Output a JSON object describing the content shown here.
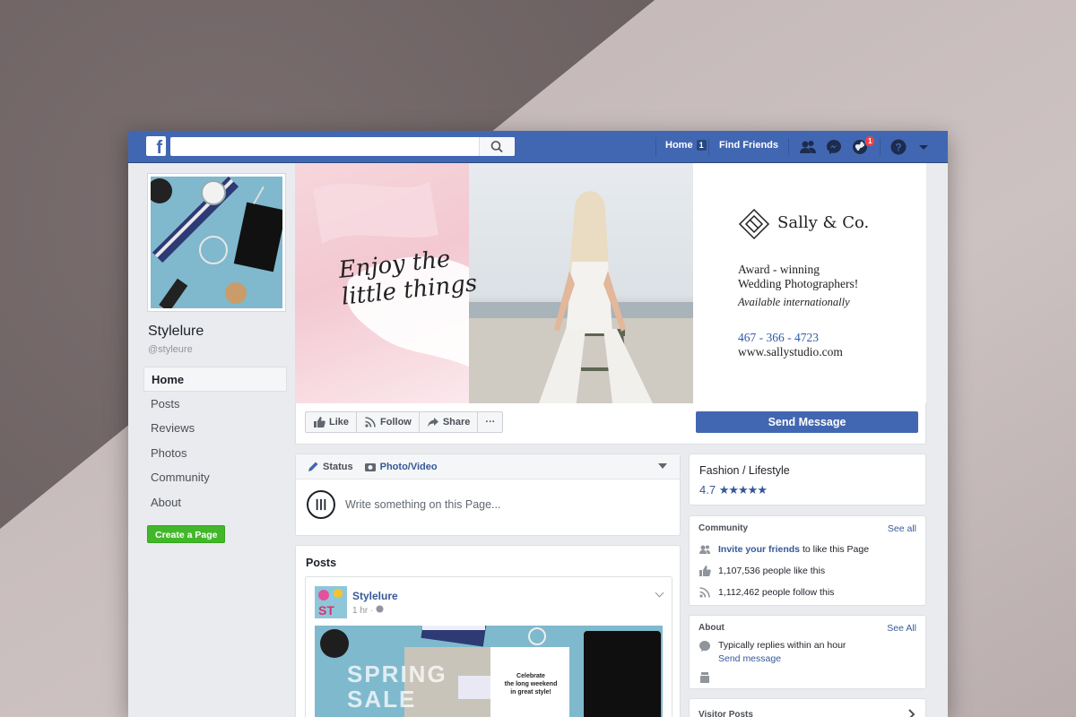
{
  "topbar": {
    "logo": "f",
    "search_placeholder": "",
    "home_label": "Home",
    "home_badge": "1",
    "find_friends_label": "Find Friends",
    "notifications_badge": "1"
  },
  "page": {
    "name": "Stylelure",
    "handle": "@styleure"
  },
  "left_nav": {
    "items": [
      {
        "label": "Home"
      },
      {
        "label": "Posts"
      },
      {
        "label": "Reviews"
      },
      {
        "label": "Photos"
      },
      {
        "label": "Community"
      },
      {
        "label": "About"
      }
    ],
    "create_page_label": "Create a Page"
  },
  "cover": {
    "script_line1": "Enjoy the",
    "script_line2": "little things",
    "brand": "Sally & Co.",
    "tagline1": "Award - winning",
    "tagline2": "Wedding Photographers!",
    "tagline3": "Available internationally",
    "phone": "467 - 366 - 4723",
    "website": "www.sallystudio.com"
  },
  "actions": {
    "like": "Like",
    "follow": "Follow",
    "share": "Share",
    "more": "···",
    "send_message": "Send Message"
  },
  "composer": {
    "status_tab": "Status",
    "photo_tab": "Photo/Video",
    "placeholder": "Write something on this Page..."
  },
  "posts": {
    "title": "Posts",
    "author": "Stylelure",
    "time": "1 hr · ",
    "image_text1": "SPRING",
    "image_text2": "SALE",
    "promo_line1": "Celebrate",
    "promo_line2": "the long weekend",
    "promo_line3": "in great style!"
  },
  "sidebar": {
    "category": "Fashion / Lifestyle",
    "rating": "4.7",
    "stars": "★★★★★",
    "community": {
      "title": "Community",
      "see_all": "See all",
      "invite_link": "Invite your friends",
      "invite_rest": " to like this Page",
      "likes": "1,107,536 people like this",
      "follows": "1,112,462 people follow this"
    },
    "about": {
      "title": "About",
      "see_all": "See All",
      "replies": "Typically replies within an hour",
      "send_message": "Send message"
    },
    "visitor_posts": "Visitor Posts"
  },
  "colors": {
    "facebook_blue": "#4267b2",
    "link_blue": "#365899",
    "create_green": "#42b72a",
    "badge_red": "#fa3e3e",
    "cover_pink": "#f3c8d1"
  },
  "icons": [
    "facebook-logo-icon",
    "search-icon",
    "friends-icon",
    "messenger-icon",
    "globe-icon",
    "help-icon",
    "caret-down-icon",
    "thumbs-up-icon",
    "rss-icon",
    "share-arrow-icon",
    "pencil-icon",
    "camera-icon",
    "globe-small-icon",
    "chevron-right-icon"
  ]
}
